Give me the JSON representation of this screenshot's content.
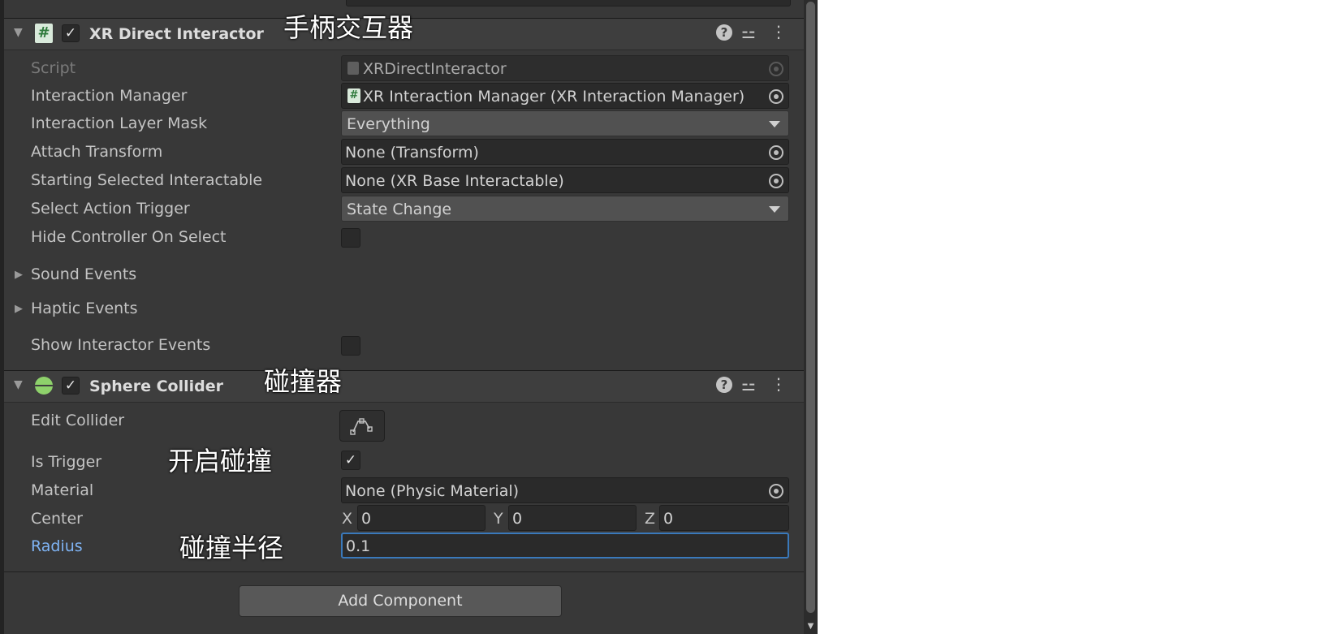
{
  "annotations": {
    "controller_interactor": "手柄交互器",
    "collider": "碰撞器",
    "enable_collision": "开启碰撞",
    "collision_radius": "碰撞半径"
  },
  "xr_direct_interactor": {
    "title": "XR Direct Interactor",
    "enabled": true,
    "icon": "script-hash-icon",
    "fields": {
      "script_label": "Script",
      "script_value": "XRDirectInteractor",
      "interaction_manager_label": "Interaction Manager",
      "interaction_manager_value": "XR Interaction Manager (XR Interaction Manager)",
      "interaction_layer_mask_label": "Interaction Layer Mask",
      "interaction_layer_mask_value": "Everything",
      "attach_transform_label": "Attach Transform",
      "attach_transform_value": "None (Transform)",
      "starting_selected_label": "Starting Selected Interactable",
      "starting_selected_value": "None (XR Base Interactable)",
      "select_action_trigger_label": "Select Action Trigger",
      "select_action_trigger_value": "State Change",
      "hide_controller_label": "Hide Controller On Select",
      "hide_controller_checked": false,
      "sound_events_label": "Sound Events",
      "haptic_events_label": "Haptic Events",
      "show_interactor_events_label": "Show Interactor Events",
      "show_interactor_events_checked": false
    }
  },
  "sphere_collider": {
    "title": "Sphere Collider",
    "enabled": true,
    "icon": "sphere-collider-icon",
    "fields": {
      "edit_collider_label": "Edit Collider",
      "is_trigger_label": "Is Trigger",
      "is_trigger_checked": true,
      "material_label": "Material",
      "material_value": "None (Physic Material)",
      "center_label": "Center",
      "center_x_label": "X",
      "center_x": "0",
      "center_y_label": "Y",
      "center_y": "0",
      "center_z_label": "Z",
      "center_z": "0",
      "radius_label": "Radius",
      "radius_value": "0.1"
    }
  },
  "add_component_label": "Add Component",
  "colors": {
    "panel_bg": "#383838",
    "header_bg": "#3e3e3e",
    "field_bg": "#2a2a2a",
    "focus_blue": "#3a79bb",
    "label_active": "#7fb4f5",
    "script_icon_green": "#8fd19e",
    "collider_icon_green": "#8ed16b"
  }
}
